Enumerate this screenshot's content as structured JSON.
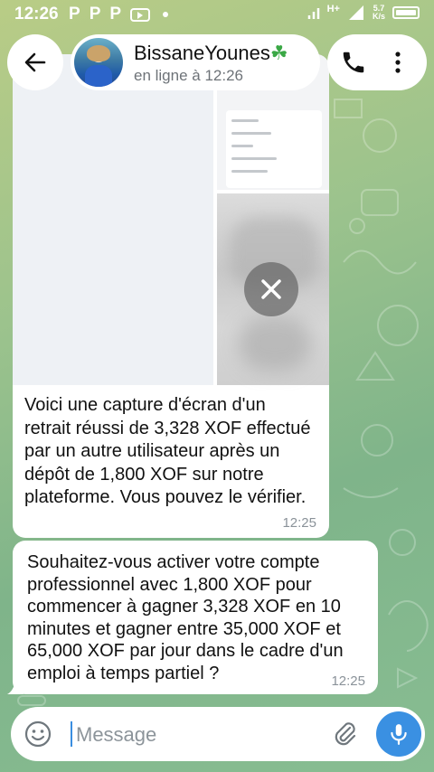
{
  "status_bar": {
    "time": "12:26",
    "apps": [
      "P",
      "P",
      "P"
    ],
    "network": "H+",
    "speed_value": "5.7",
    "speed_unit": "K/s"
  },
  "header": {
    "contact_name": "BissaneYounes",
    "contact_emoji": "☘",
    "contact_status": "en ligne à 12:26"
  },
  "messages": [
    {
      "type": "media",
      "caption": "Voici une capture d'écran d'un retrait réussi de 3,328 XOF effectué par un autre utilisateur après un dépôt de 1,800 XOF sur notre plateforme. Vous pouvez le vérifier.",
      "time": "12:25"
    },
    {
      "type": "text",
      "text": "Souhaitez-vous activer votre compte professionnel avec 1,800 XOF pour commencer à gagner 3,328 XOF en 10 minutes et gagner entre 35,000 XOF et 65,000 XOF par jour dans le cadre d'un emploi à temps partiel ?",
      "time": "12:25"
    }
  ],
  "input": {
    "placeholder": "Message",
    "value": ""
  },
  "icons": {
    "back": "arrow-left-icon",
    "call": "phone-icon",
    "more": "more-vertical-icon",
    "cancel_download": "close-icon",
    "emoji": "emoji-icon",
    "attach": "paperclip-icon",
    "mic": "microphone-icon"
  },
  "colors": {
    "accent": "#3a90e2",
    "bubble": "#ffffff",
    "secondary_text": "#6e7378"
  }
}
